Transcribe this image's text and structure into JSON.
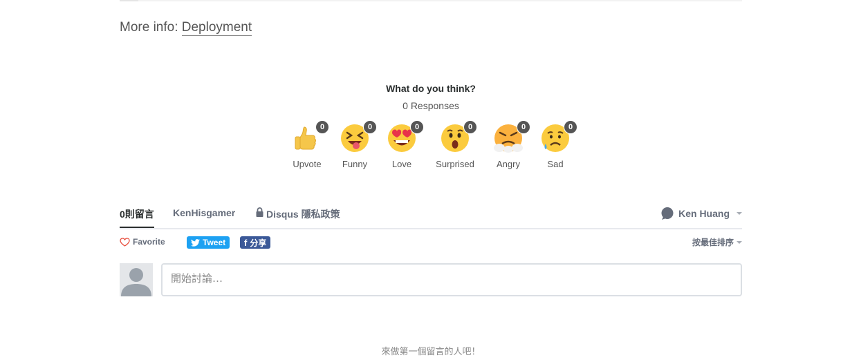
{
  "more_info": {
    "prefix": "More info:",
    "link": "Deployment"
  },
  "reactions_section": {
    "question": "What do you think?",
    "responses": "0 Responses",
    "items": [
      {
        "label": "Upvote",
        "count": "0",
        "icon": "thumbs-up-icon"
      },
      {
        "label": "Funny",
        "count": "0",
        "icon": "laughing-face-icon"
      },
      {
        "label": "Love",
        "count": "0",
        "icon": "heart-eyes-icon"
      },
      {
        "label": "Surprised",
        "count": "0",
        "icon": "surprised-face-icon"
      },
      {
        "label": "Angry",
        "count": "0",
        "icon": "angry-face-icon"
      },
      {
        "label": "Sad",
        "count": "0",
        "icon": "sad-face-icon"
      }
    ]
  },
  "tabs": {
    "comments": "0則留言",
    "community": "KenHisgamer",
    "privacy": "Disqus 隱私政策",
    "user": "Ken Huang"
  },
  "toolbar": {
    "favorite": "Favorite",
    "tweet": "Tweet",
    "share": "分享",
    "sort": "按最佳排序"
  },
  "compose": {
    "placeholder": "開始討論…"
  },
  "empty_message": "來做第一個留言的人吧！",
  "colors": {
    "accent": "#2a2e2e",
    "twitter": "#1da1f2",
    "facebook": "#3b5998",
    "heart": "#e74c3c"
  }
}
